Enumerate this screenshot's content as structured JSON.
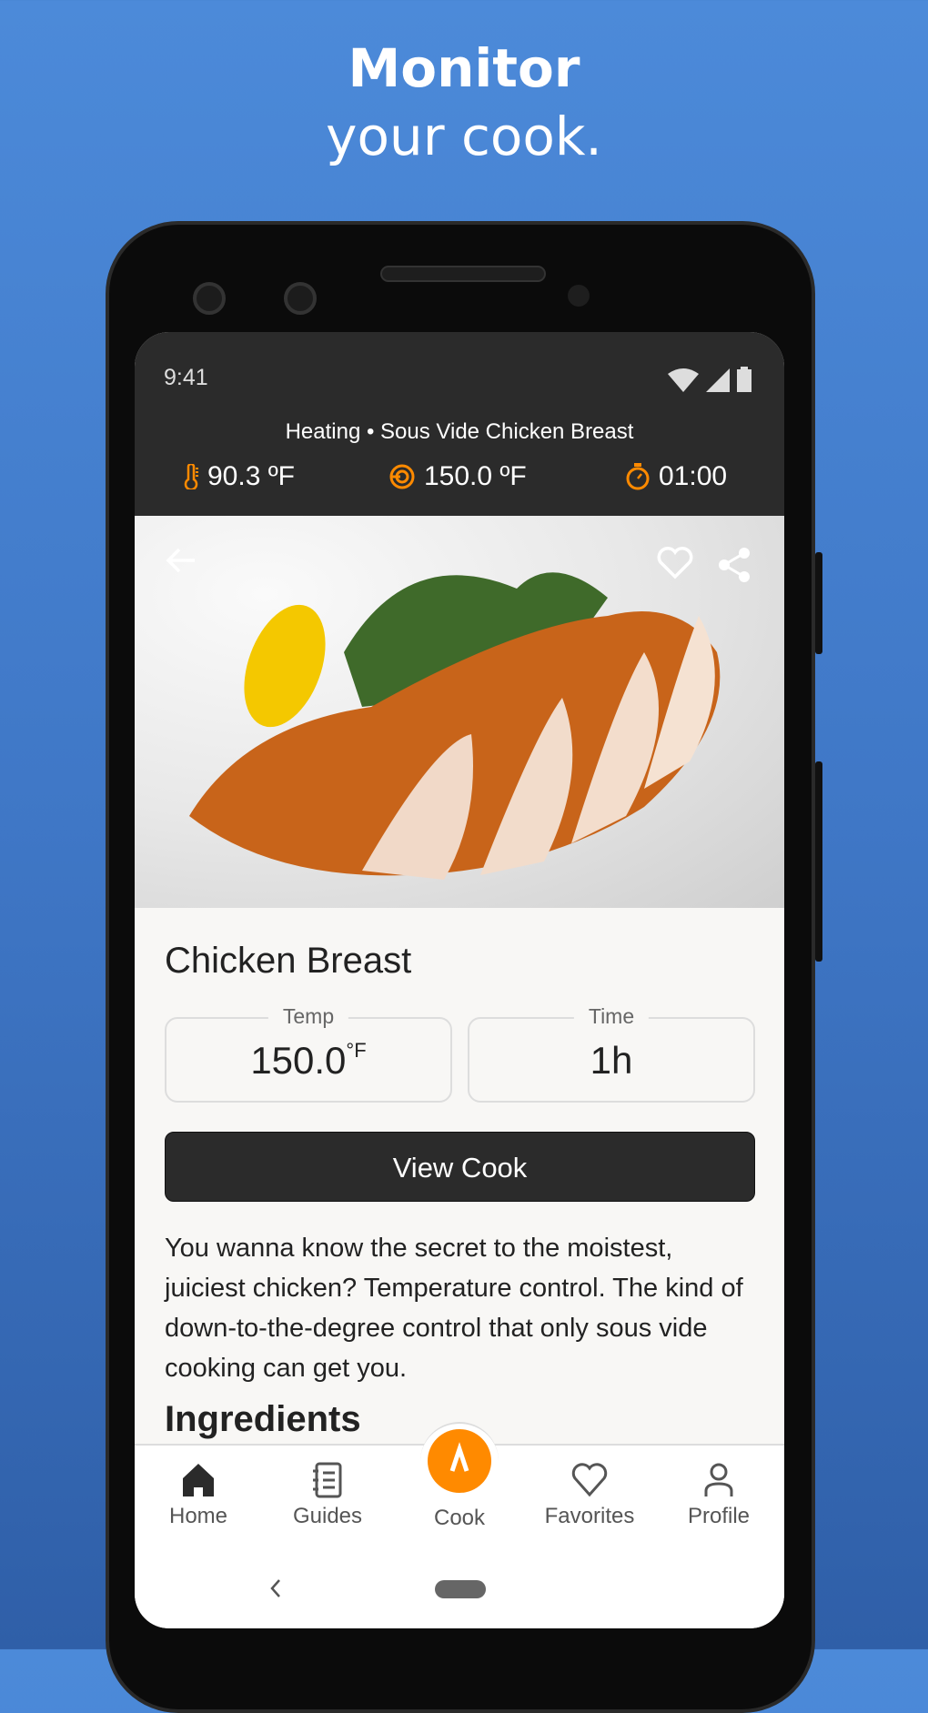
{
  "hero": {
    "line1": "Monitor",
    "line2": "your cook."
  },
  "status_bar": {
    "time": "9:41"
  },
  "cook_status": {
    "text": "Heating • Sous Vide Chicken Breast",
    "current_temp": "90.3 ºF",
    "target_temp": "150.0 ºF",
    "timer": "01:00"
  },
  "recipe": {
    "title": "Chicken Breast",
    "temp_label": "Temp",
    "temp_value": "150.0",
    "temp_unit": "°F",
    "time_label": "Time",
    "time_value": "1h",
    "view_button": "View Cook",
    "description": "You wanna know the secret to the moistest, juiciest chicken? Temperature control. The kind of down-to-the-degree control that only sous vide cooking can get you.",
    "section": "Ingredients"
  },
  "nav": {
    "items": [
      {
        "label": "Home",
        "icon": "home-icon"
      },
      {
        "label": "Guides",
        "icon": "guides-icon"
      },
      {
        "label": "Cook",
        "icon": "cook-icon"
      },
      {
        "label": "Favorites",
        "icon": "heart-icon"
      },
      {
        "label": "Profile",
        "icon": "profile-icon"
      }
    ]
  },
  "colors": {
    "accent": "#ff8a00",
    "header": "#2b2b2b",
    "background": "#4c8ad9"
  }
}
